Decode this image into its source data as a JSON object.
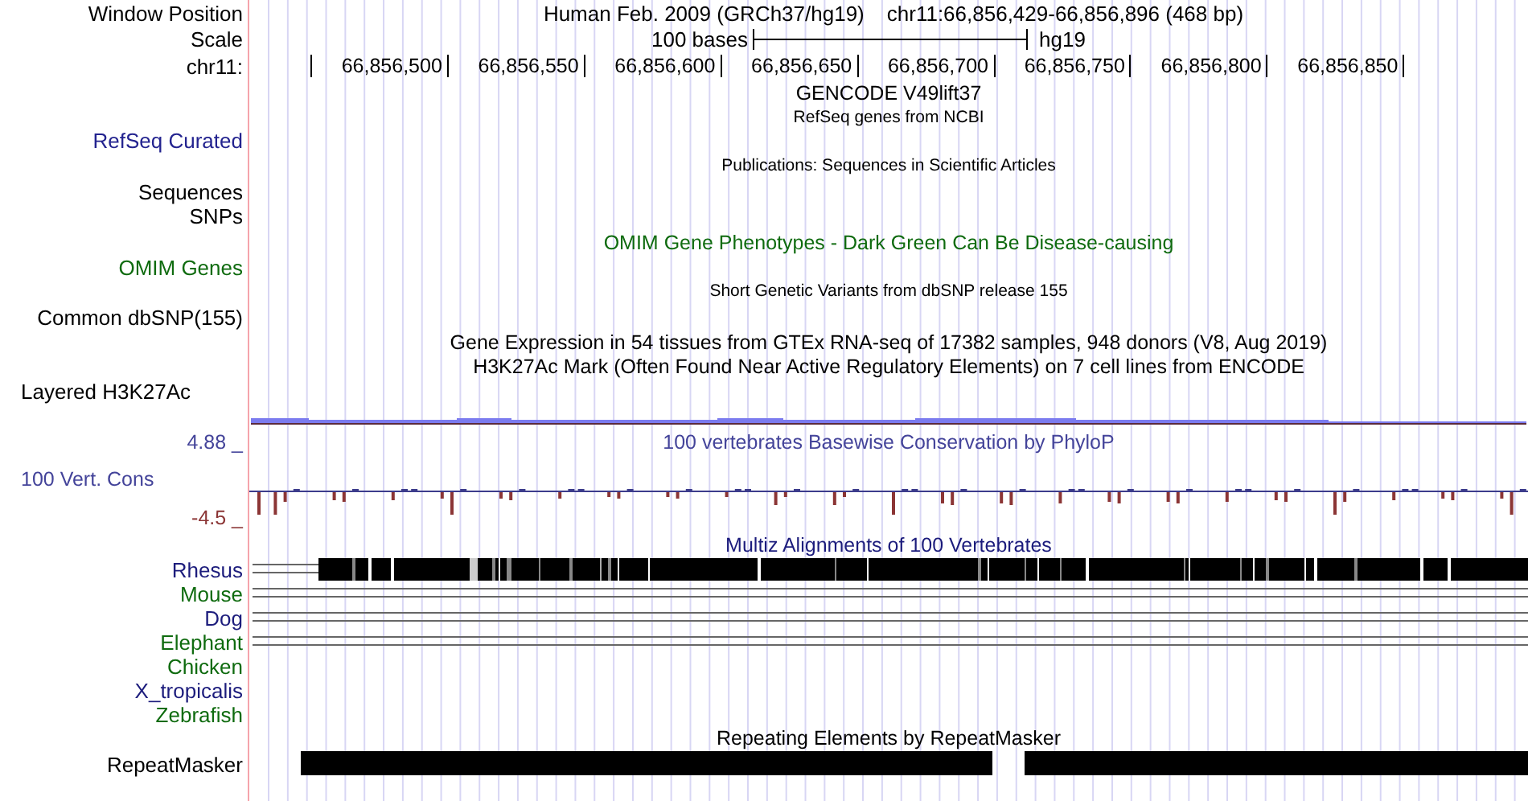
{
  "header": {
    "label": "Window Position",
    "assembly": "Human Feb. 2009 (GRCh37/hg19)",
    "position": "chr11:66,856,429-66,856,896 (468 bp)"
  },
  "scale": {
    "label": "Scale",
    "length": "100 bases",
    "assembly": "hg19"
  },
  "ruler": {
    "label": "chr11:",
    "ticks": [
      "66,856,500",
      "66,856,550",
      "66,856,600",
      "66,856,650",
      "66,856,700",
      "66,856,750",
      "66,856,800",
      "66,856,850"
    ]
  },
  "rows": [
    {
      "kind": "heading",
      "title": "GENCODE V49lift37",
      "color": "#000000"
    },
    {
      "kind": "caption",
      "title": "RefSeq genes from NCBI"
    },
    {
      "kind": "label",
      "label": "RefSeq Curated",
      "color": "#23238f"
    },
    {
      "kind": "caption",
      "title": "Publications: Sequences in Scientific Articles"
    },
    {
      "kind": "label",
      "label": "Sequences",
      "color": "#000000"
    },
    {
      "kind": "label",
      "label": "SNPs",
      "color": "#000000"
    },
    {
      "kind": "heading",
      "title": "OMIM Gene Phenotypes - Dark Green Can Be Disease-causing",
      "color": "#0f6b0f"
    },
    {
      "kind": "label",
      "label": "OMIM Genes",
      "color": "#0f6b0f"
    },
    {
      "kind": "caption",
      "title": "Short Genetic Variants from dbSNP release 155"
    },
    {
      "kind": "label",
      "label": "Common dbSNP(155)",
      "color": "#000000"
    },
    {
      "kind": "heading",
      "title": "Gene Expression in 54 tissues from GTEx RNA-seq of 17382 samples, 948 donors (V8, Aug 2019)",
      "color": "#000000"
    },
    {
      "kind": "heading",
      "title": "H3K27Ac Mark (Often Found Near Active Regulatory Elements) on 7 cell lines from ENCODE",
      "color": "#000000"
    },
    {
      "kind": "group-label",
      "label": "Layered H3K27Ac",
      "color": "#000000"
    },
    {
      "kind": "coverage"
    },
    {
      "kind": "wiggle",
      "max": "4.88 _",
      "title": "100 vertebrates Basewise Conservation by PhyloP",
      "label": "100 Vert. Cons",
      "min": "-4.5 _"
    },
    {
      "kind": "heading",
      "title": "Multiz Alignments of 100 Vertebrates",
      "color": "#1c1c7c"
    },
    {
      "kind": "species-blocks",
      "label": "Rhesus",
      "color": "#1c1c7c"
    },
    {
      "kind": "species-lines",
      "label": "Mouse",
      "color": "#0f6b0f"
    },
    {
      "kind": "species-lines",
      "label": "Dog",
      "color": "#1c1c7c"
    },
    {
      "kind": "species-lines",
      "label": "Elephant",
      "color": "#0f6b0f"
    },
    {
      "kind": "species",
      "label": "Chicken",
      "color": "#0f6b0f"
    },
    {
      "kind": "species",
      "label": "X_tropicalis",
      "color": "#1c1c7c"
    },
    {
      "kind": "species",
      "label": "Zebrafish",
      "color": "#0f6b0f"
    },
    {
      "kind": "heading",
      "title": "Repeating Elements by RepeatMasker",
      "color": "#000000"
    },
    {
      "kind": "repeats",
      "label": "RepeatMasker"
    }
  ]
}
